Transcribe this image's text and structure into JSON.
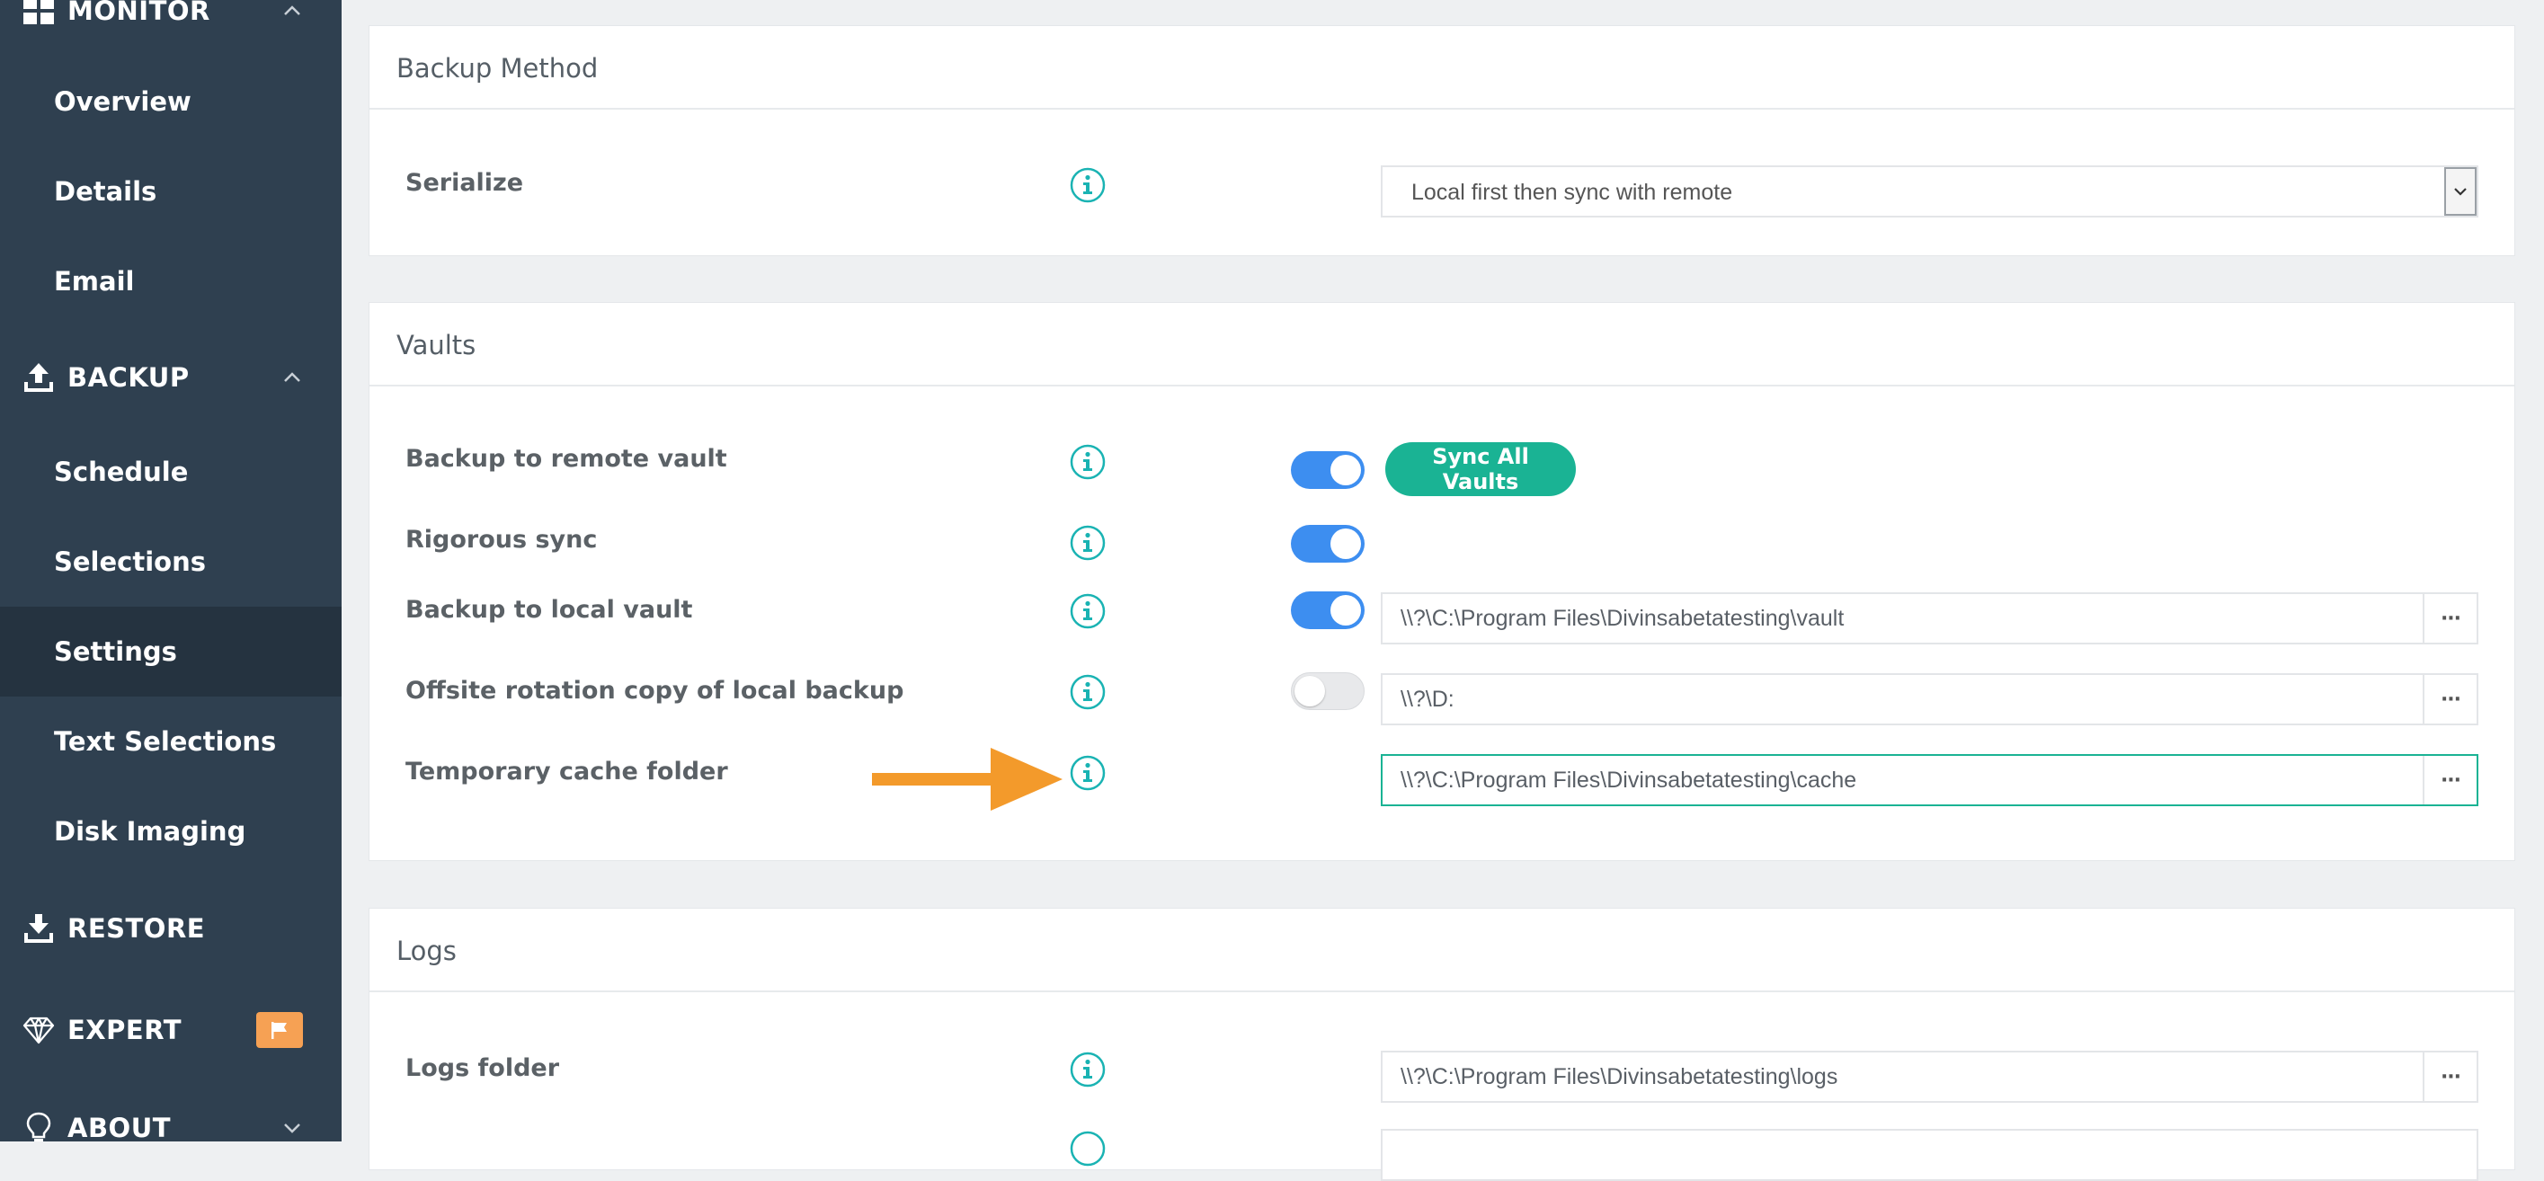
{
  "sidebar": {
    "sections": [
      {
        "label": "MONITOR",
        "icon": "dashboard-grid-icon"
      },
      {
        "label": "BACKUP",
        "icon": "upload-tray-icon"
      },
      {
        "label": "RESTORE",
        "icon": "download-tray-icon"
      },
      {
        "label": "EXPERT",
        "icon": "diamond-icon",
        "badge_icon": "flag-icon"
      },
      {
        "label": "ABOUT",
        "icon": "lightbulb-icon"
      }
    ],
    "monitor_items": [
      "Overview",
      "Details",
      "Email"
    ],
    "backup_items": [
      "Schedule",
      "Selections",
      "Settings",
      "Text Selections",
      "Disk Imaging"
    ],
    "active_item": "Settings"
  },
  "backup_method": {
    "title": "Backup Method",
    "serialize_label": "Serialize",
    "serialize_value": "Local first then sync with remote"
  },
  "vaults": {
    "title": "Vaults",
    "remote_label": "Backup to remote vault",
    "remote_enabled": true,
    "sync_button": "Sync All Vaults",
    "rigorous_label": "Rigorous sync",
    "rigorous_enabled": true,
    "local_label": "Backup to local vault",
    "local_enabled": true,
    "local_path": "\\\\?\\C:\\Program Files\\Divinsabetatesting\\vault",
    "offsite_label": "Offsite rotation copy of local backup",
    "offsite_enabled": false,
    "offsite_path": "\\\\?\\D:",
    "cache_label": "Temporary cache folder",
    "cache_path": "\\\\?\\C:\\Program Files\\Divinsabetatesting\\cache"
  },
  "logs": {
    "title": "Logs",
    "folder_label": "Logs folder",
    "folder_path": "\\\\?\\C:\\Program Files\\Divinsabetatesting\\logs"
  },
  "browse_button_label": "···",
  "colors": {
    "sidebar_bg": "#2f4050",
    "sidebar_active": "#253340",
    "accent_teal": "#1ab394",
    "toggle_on": "#3d8ef0",
    "info_icon": "#1ab3b3",
    "annotation_arrow": "#f39a2b",
    "expert_badge": "#f6a154"
  }
}
